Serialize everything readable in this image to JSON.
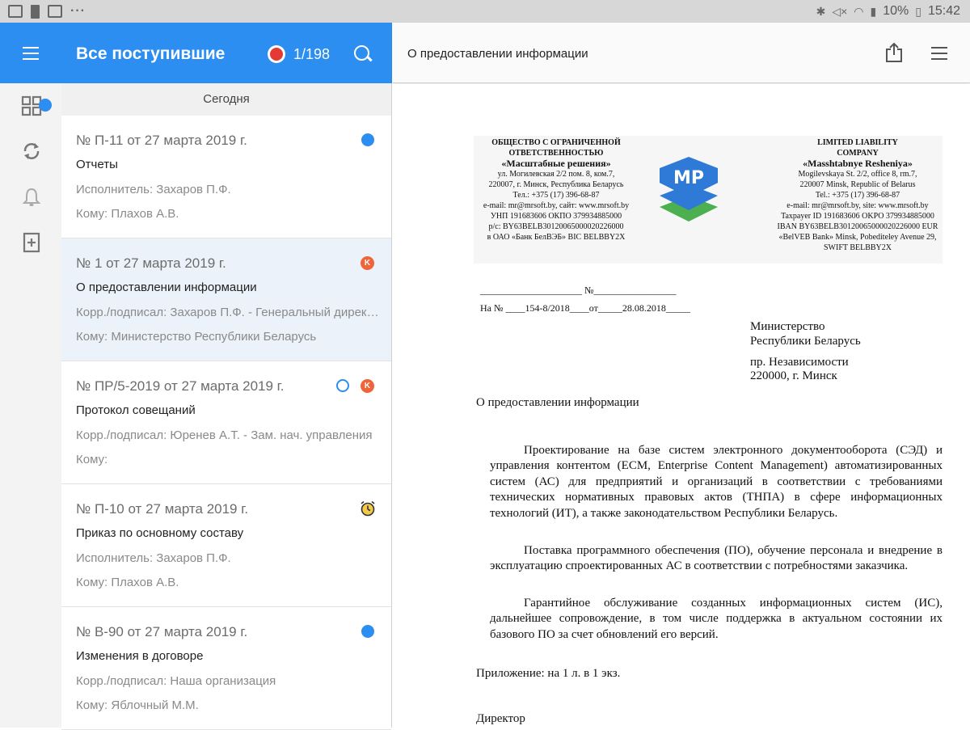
{
  "status_bar": {
    "battery": "10%",
    "time": "15:42",
    "more": "···"
  },
  "list_header": {
    "title": "Все поступившие",
    "counter": "1/198"
  },
  "section_label": "Сегодня",
  "items": [
    {
      "number": "№ П-11 от 27 марта 2019 г.",
      "subject": "Отчеты",
      "line1": "Исполнитель: Захаров П.Ф.",
      "line2": "Кому: Плахов А.В."
    },
    {
      "number": "№ 1 от 27 марта 2019 г.",
      "subject": "О предоставлении информации",
      "line1": "Корр./подписал: Захаров П.Ф. - Генеральный директор",
      "line2": "Кому: Министерство Республики Беларусь",
      "badge": "K"
    },
    {
      "number": "№ ПР/5-2019 от 27 марта 2019 г.",
      "subject": "Протокол совещаний",
      "line1": "Корр./подписал: Юренев А.Т. - Зам. нач. управления",
      "line2": "Кому:",
      "badge": "K"
    },
    {
      "number": "№ П-10 от 27 марта 2019 г.",
      "subject": "Приказ по основному составу",
      "line1": "Исполнитель: Захаров П.Ф.",
      "line2": "Кому: Плахов А.В."
    },
    {
      "number": "№ В-90 от 27 марта 2019 г.",
      "subject": "Изменения в договоре",
      "line1": "Корр./подписал: Наша организация",
      "line2": "Кому: Яблочный М.М."
    }
  ],
  "viewer": {
    "title": "О предоставлении информации"
  },
  "letterhead": {
    "left": {
      "l1": "ОБЩЕСТВО С ОГРАНИЧЕННОЙ",
      "l2": "ОТВЕТСТВЕННОСТЬЮ",
      "name": "«Масштабные решения»",
      "l3": "ул. Могилевская 2/2 пом. 8, ком.7,",
      "l4": "220007, г. Минск, Республика Беларусь",
      "l5": "Тел.: +375 (17) 396-68-87",
      "l6": "e-mail: mr@mrsoft.by, сайт: www.mrsoft.by",
      "l7": "УНП 191683606 ОКПО 379934885000",
      "l8": "р/с: BY63BELB30120065000020226000",
      "l9": "в ОАО «Банк БелВЭБ» BIC BELBBY2X"
    },
    "right": {
      "l1": "LIMITED LIABILITY",
      "l2": "COMPANY",
      "name": "«Masshtabnye Resheniya»",
      "l3": "Mogilevskaya St. 2/2, office 8, rm.7,",
      "l4": "220007 Minsk, Republic of Belarus",
      "l5": "Tel.: +375 (17) 396-68-87",
      "l6": "e-mail: mr@mrsoft.by, site: www.mrsoft.by",
      "l7": "Taxpayer ID 191683606 OKPO 379934885000",
      "l8": "IBAN BY63BELB30120065000020226000 EUR",
      "l9": "«BelVEB Bank» Minsk, Pobediteley Avenue 29,",
      "l10": "SWIFT BELBBY2X"
    },
    "logo_text": "MP"
  },
  "document": {
    "reg_line1": "_____________________ №_________________",
    "reg_line2": "На № ____154-8/2018____от_____28.08.2018_____",
    "addressee1": "Министерство",
    "addressee2": "Республики Беларусь",
    "addressee3": "пр. Независимости",
    "addressee4": "220000, г. Минск",
    "subject": "О предоставлении информации",
    "paragraphs": [
      "Проектирование на базе систем электронного документооборота (СЭД) и управления контентом (ECM, Enterprise Content Management) автоматизированных систем (АС) для предприятий и организаций в соответствии с требованиями технических нормативных правовых актов (ТНПА) в сфере информационных технологий (ИТ), а также законодательством Республики Беларусь.",
      "Поставка программного обеспечения (ПО), обучение персонала и внедрение в эксплуатацию спроектированных АС в соответствии с потребностями заказчика.",
      "Гарантийное обслуживание созданных информационных систем (ИС), дальнейшее сопровождение, в том числе поддержка в актуальном состоянии их базового ПО за счет обновлений его версий."
    ],
    "appendix": "Приложение: на 1 л. в 1 экз.",
    "signature": "Директор"
  },
  "colors": {
    "accent": "#2c8ef0",
    "badge_orange": "#f0643a",
    "record_red": "#e53935",
    "alarm_yellow": "#f2c94c"
  }
}
